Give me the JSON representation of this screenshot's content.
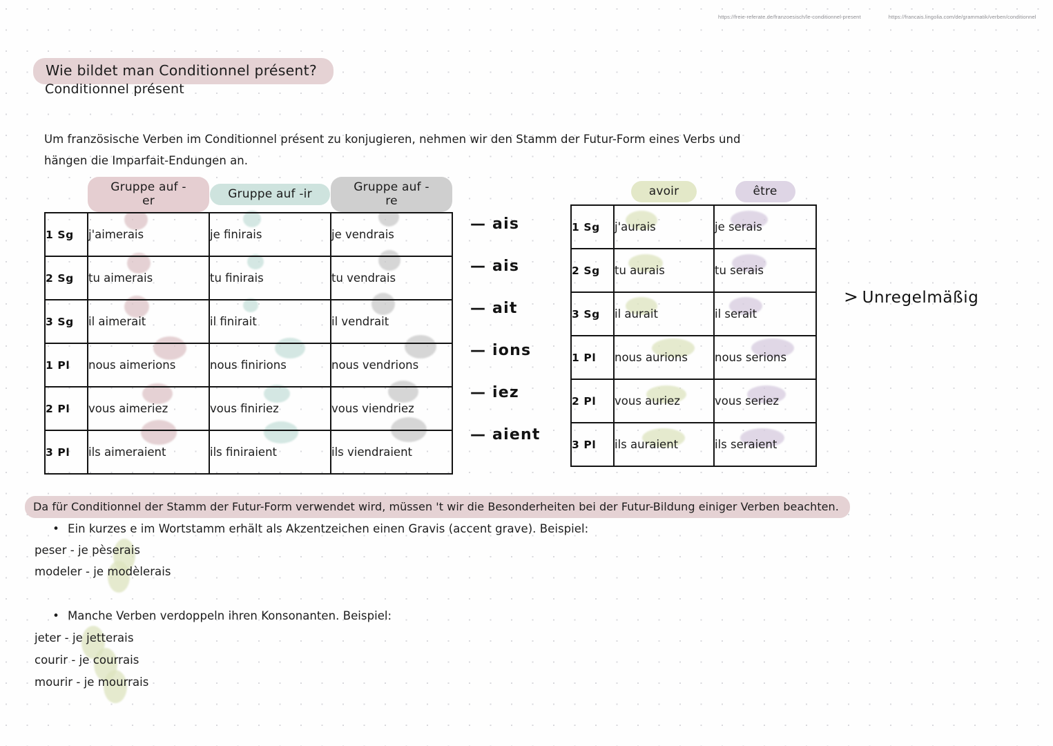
{
  "sources": [
    "https://freie-referate.de/franzoesisch/le-conditionnel-present",
    "https://francais.lingolia.com/de/grammatik/verben/conditionnel"
  ],
  "header": {
    "title": "Wie bildet man Conditionnel présent?",
    "subtitle": "Conditionnel présent",
    "title_highlight": "#e5d2d4"
  },
  "intro": "Um französische Verben im Conditionnel présent zu konjugieren, nehmen wir den Stamm der Futur-Form eines Verbs und hängen die Imparfait-Endungen an.",
  "table_regular": {
    "headers": [
      "",
      "Gruppe auf -er",
      "Gruppe auf -ir",
      "Gruppe auf -re"
    ],
    "header_colors": [
      "",
      "#e5ced1",
      "#cee3de",
      "#cfcfcf"
    ],
    "rows": [
      {
        "label": "1 Sg",
        "cells": [
          "j'aimerais",
          "je finirais",
          "je vendrais"
        ]
      },
      {
        "label": "2 Sg",
        "cells": [
          "tu aimerais",
          "tu finirais",
          "tu vendrais"
        ]
      },
      {
        "label": "3 Sg",
        "cells": [
          "il aimerait",
          "il finirait",
          "il vendrait"
        ]
      },
      {
        "label": "1 Pl",
        "cells": [
          "nous aimerions",
          "nous finirions",
          "nous vendrions"
        ]
      },
      {
        "label": "2 Pl",
        "cells": [
          "vous aimeriez",
          "vous finiriez",
          "vous viendriez"
        ]
      },
      {
        "label": "3 Pl",
        "cells": [
          "ils aimeraient",
          "ils finiraient",
          "ils viendraient"
        ]
      }
    ]
  },
  "endings": [
    "— ais",
    "— ais",
    "— ait",
    "— ions",
    "— iez",
    "— aient"
  ],
  "table_irregular": {
    "headers": [
      "",
      "avoir",
      "être"
    ],
    "header_colors": [
      "",
      "#e3e8c8",
      "#ded5e5"
    ],
    "rows": [
      {
        "label": "1 Sg",
        "cells": [
          "j'aurais",
          "je serais"
        ]
      },
      {
        "label": "2 Sg",
        "cells": [
          "tu aurais",
          "tu serais"
        ]
      },
      {
        "label": "3 Sg",
        "cells": [
          "il aurait",
          "il serait"
        ]
      },
      {
        "label": "1 Pl",
        "cells": [
          "nous aurions",
          "nous serions"
        ]
      },
      {
        "label": "2 Pl",
        "cells": [
          "vous auriez",
          "vous seriez"
        ]
      },
      {
        "label": "3 Pl",
        "cells": [
          "ils auraient",
          "ils seraient"
        ]
      }
    ]
  },
  "irregular_note": {
    "chevron": ">",
    "text": "Unregelmäßig"
  },
  "note": "Da für Conditionnel der Stamm der Futur-Form verwendet wird, müssen 't wir die Besonderheiten bei der Futur-Bildung einiger Verben beachten.",
  "bullets": [
    {
      "marker": "•",
      "text": "Ein kurzes e im Wortstamm erhält als Akzentzeichen einen Gravis (accent grave). Beispiel:",
      "examples": [
        "peser - je pèserais",
        "modeler - je modèlerais"
      ]
    },
    {
      "marker": "•",
      "text": "Manche Verben verdoppeln ihren Konsonanten. Beispiel:",
      "examples": [
        "jeter - je jetterais",
        "courir - je courrais",
        "mourir - je mourrais"
      ]
    }
  ],
  "marker_colors": {
    "pink": "#ddc3c6",
    "mint": "#c6e0da",
    "gray": "#c9c9c9",
    "olive": "#dde4bf",
    "lavender": "#d6cbdf"
  }
}
